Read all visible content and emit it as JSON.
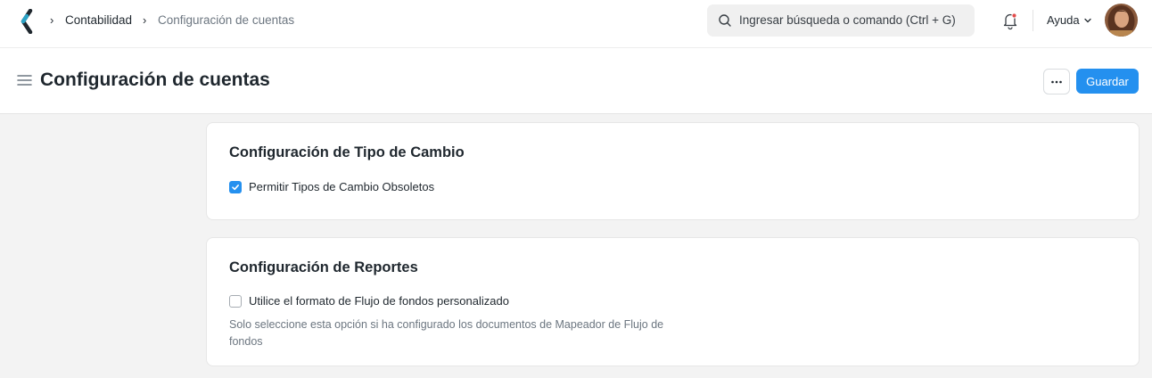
{
  "navbar": {
    "breadcrumbs": [
      "Contabilidad",
      "Configuración de cuentas"
    ],
    "search_placeholder": "Ingresar búsqueda o comando (Ctrl + G)",
    "help_label": "Ayuda",
    "icons": [
      "app-logo-icon",
      "chevron-right-icon",
      "search-icon",
      "bell-icon",
      "chevron-down-icon",
      "avatar"
    ]
  },
  "page": {
    "title": "Configuración de cuentas",
    "more_label": "···",
    "save_label": "Guardar"
  },
  "sections": [
    {
      "title": "Configuración de Tipo de Cambio",
      "field_label": "Permitir Tipos de Cambio Obsoletos",
      "checked": true
    },
    {
      "title": "Configuración de Reportes",
      "field_label": "Utilice el formato de Flujo de fondos personalizado",
      "checked": false,
      "description": "Solo seleccione esta opción si ha configurado los documentos de Mapeador de Flujo de fondos"
    }
  ],
  "colors": {
    "accent": "#2490ef",
    "text": "#1f272e",
    "muted": "#6c7680",
    "background": "#f3f3f3"
  }
}
